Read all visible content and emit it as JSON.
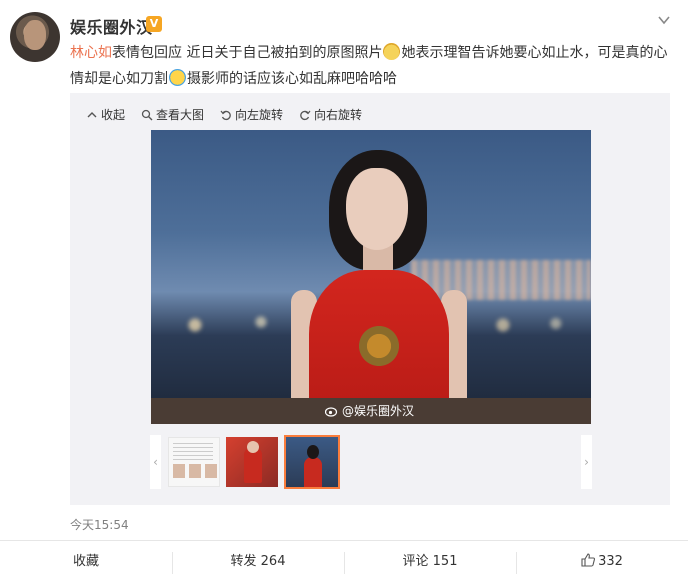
{
  "post": {
    "username": "娱乐圈外汉",
    "verified_badge": "V",
    "text_mention": "林心如",
    "text_part1": "表情包回应 近日关于自己被拍到的原图照片",
    "text_part2": "她表示理智告诉她要心如止水，可是真的心情却是心如刀割",
    "text_part3": "摄影师的话应该心如乱麻吧哈哈哈",
    "timestamp": "今天15:54"
  },
  "media_toolbar": {
    "collapse_label": "收起",
    "view_large_label": "查看大图",
    "rotate_left_label": "向左旋转",
    "rotate_right_label": "向右旋转"
  },
  "photo": {
    "watermark": "@娱乐圈外汉"
  },
  "thumbnails": {
    "prev_arrow": "‹",
    "next_arrow": "›",
    "selected_index": 3
  },
  "footer": {
    "favorite_label": "收藏",
    "repost_label": "转发 264",
    "comment_label": "评论 151",
    "like_count": "332"
  },
  "colors": {
    "mention": "#eb7350",
    "verified": "#f6a623",
    "thumb_selected_border": "#fa7d3c"
  },
  "icons": [
    "chevron-down-icon",
    "magnifier-icon",
    "rotate-left-icon",
    "rotate-right-icon",
    "weibo-logo-icon",
    "thumbs-up-icon",
    "laughing-emoji",
    "crying-laughing-emoji"
  ]
}
